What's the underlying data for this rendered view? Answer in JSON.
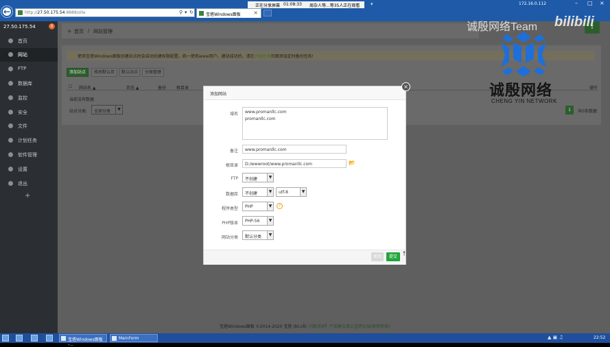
{
  "browser": {
    "address_prefix": "http://",
    "address_host": "27.50.175.54",
    "address_path": ":8888/site",
    "tab_title": "宝塔Windows面板"
  },
  "share_bar": {
    "label": "正在分享屏幕",
    "time": "01:08:33",
    "viewers": "周杂人等...等35人正在观看"
  },
  "system_status": {
    "ip": "172.16.0.112"
  },
  "sidebar": {
    "server_ip": "27.50.175.54",
    "badge": "0",
    "items": [
      {
        "label": "首页",
        "icon": "home-icon"
      },
      {
        "label": "网站",
        "icon": "globe-icon"
      },
      {
        "label": "FTP",
        "icon": "ftp-icon"
      },
      {
        "label": "数据库",
        "icon": "database-icon"
      },
      {
        "label": "监控",
        "icon": "monitor-icon"
      },
      {
        "label": "安全",
        "icon": "shield-icon"
      },
      {
        "label": "文件",
        "icon": "folder-icon"
      },
      {
        "label": "计划任务",
        "icon": "clock-icon"
      },
      {
        "label": "软件管理",
        "icon": "grid-icon"
      },
      {
        "label": "设置",
        "icon": "gear-icon"
      },
      {
        "label": "退出",
        "icon": "exit-icon"
      }
    ],
    "add": "+"
  },
  "breadcrumb": {
    "home": "首页",
    "sep": "/",
    "current": "网站管理"
  },
  "notice": {
    "text_before": "使用宝塔Windows面板创建站点时会自动创建权限配置，统一使用www用户。建站成功后，请在",
    "link": "计划任务",
    "text_after": "页面添加定时备份任务!"
  },
  "toolbar": {
    "add_site": "添加站点",
    "modify_default": "修改默认页",
    "default_site": "默认站点",
    "category_manage": "分类管理"
  },
  "table": {
    "headers": [
      "网站名 ▲",
      "状态 ▲",
      "备份",
      "根目录",
      "操作"
    ],
    "empty": "当前没有数据"
  },
  "category_filter": {
    "label": "站点分类:",
    "value": "全部分类"
  },
  "pagination": {
    "page": "1",
    "info": "共0条数据"
  },
  "watermark": {
    "team": "诚殷网络Team",
    "bili": "bilibili",
    "cn": "诚殷网络",
    "en": "CHENG YIN NETWORK"
  },
  "modal": {
    "title": "添加网站",
    "domain_label": "域名",
    "domain_lines": [
      "www.promanllc.com",
      "promanllc.com"
    ],
    "remark_label": "备注",
    "remark_value": "www.promanllc.com",
    "root_label": "根目录",
    "root_value": "D:/wwwroot/www.promanllc.com",
    "ftp_label": "FTP",
    "ftp_value": "不创建",
    "db_label": "数据库",
    "db_value": "不创建",
    "db_charset": "utf-8",
    "type_label": "程序类型",
    "type_value": "PHP",
    "php_label": "PHP版本",
    "php_value": "PHP-56",
    "category_label": "网站分类",
    "category_value": "默认分类",
    "close_btn": "关闭",
    "submit_btn": "提交"
  },
  "footer": {
    "copyright": "宝塔Windows面板 ©2014-2020 宝塔 (bt.cn)",
    "help": "问题求助",
    "suggest": "产品建议请上宝塔论坛",
    "manual": "《使用手册》",
    "sep": "|"
  },
  "taskbar": {
    "task1": "宝塔Windows面板 -...",
    "task2": "MainForm",
    "clock": "22:52"
  }
}
